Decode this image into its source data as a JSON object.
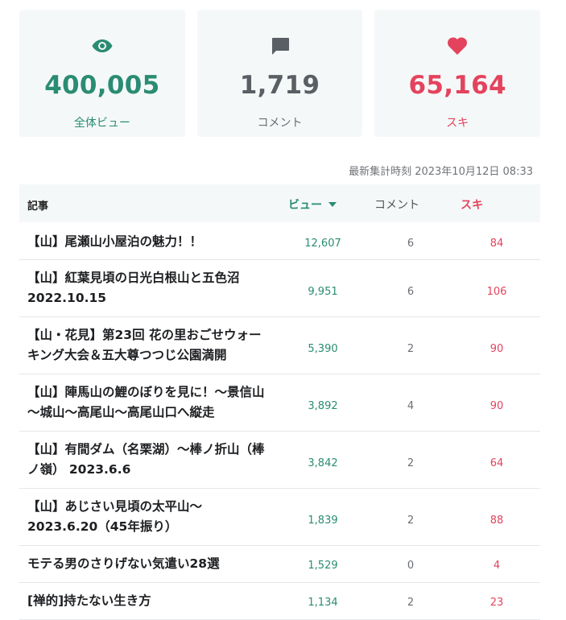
{
  "stats": {
    "views": {
      "value": "400,005",
      "label": "全体ビュー",
      "icon": "eye-icon"
    },
    "comments": {
      "value": "1,719",
      "label": "コメント",
      "icon": "comment-icon"
    },
    "likes": {
      "value": "65,164",
      "label": "スキ",
      "icon": "heart-icon"
    }
  },
  "updated_text": "最新集計時刻 2023年10月12日 08:33",
  "table": {
    "headers": {
      "title": "記事",
      "views": "ビュー",
      "comments": "コメント",
      "likes": "スキ"
    },
    "rows": [
      {
        "title": "【山】尾瀬山小屋泊の魅力！！",
        "views": "12,607",
        "comments": "6",
        "likes": "84"
      },
      {
        "title": "【山】紅葉見頃の日光白根山と五色沼 2022.10.15",
        "views": "9,951",
        "comments": "6",
        "likes": "106"
      },
      {
        "title": "【山・花見】第23回 花の里おごせウォーキング大会＆五大尊つつじ公園満開",
        "views": "5,390",
        "comments": "2",
        "likes": "90"
      },
      {
        "title": "【山】陣馬山の鯉のぼりを見に！～景信山～城山～高尾山～高尾山口へ縦走",
        "views": "3,892",
        "comments": "4",
        "likes": "90"
      },
      {
        "title": "【山】有間ダム（名栗湖）～棒ノ折山（棒ノ嶺） 2023.6.6",
        "views": "3,842",
        "comments": "2",
        "likes": "64"
      },
      {
        "title": "【山】あじさい見頃の太平山～ 2023.6.20（45年振り）",
        "views": "1,839",
        "comments": "2",
        "likes": "88"
      },
      {
        "title": "モテる男のさりげない気遣い28選",
        "views": "1,529",
        "comments": "0",
        "likes": "4"
      },
      {
        "title": "[禅的]持たない生き方",
        "views": "1,134",
        "comments": "2",
        "likes": "23"
      }
    ]
  },
  "colors": {
    "views": "#2a8c72",
    "comments": "#5a5f66",
    "likes": "#e4435d",
    "card_bg": "#f5f8f8"
  }
}
